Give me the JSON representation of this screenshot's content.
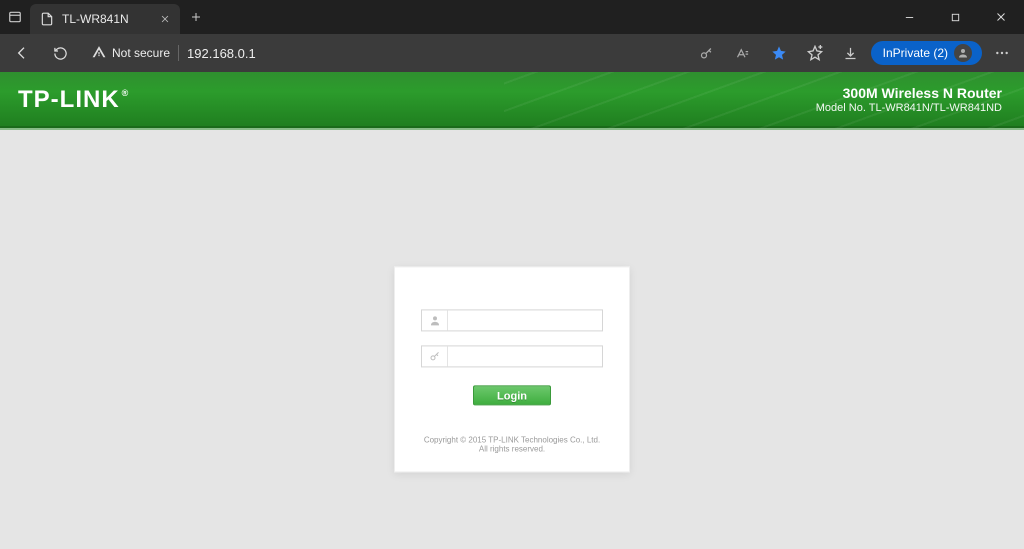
{
  "browser": {
    "tab_title": "TL-WR841N",
    "not_secure_label": "Not secure",
    "url": "192.168.0.1",
    "inprivate_label": "InPrivate (2)"
  },
  "header": {
    "brand": "TP-LINK",
    "reg": "®",
    "product_line1": "300M Wireless N Router",
    "product_line2": "Model No. TL-WR841N/TL-WR841ND"
  },
  "login": {
    "username_value": "",
    "username_placeholder": "",
    "password_value": "",
    "password_placeholder": "",
    "button_label": "Login"
  },
  "footer": {
    "copyright": "Copyright © 2015 TP-LINK Technologies Co., Ltd. All rights reserved."
  }
}
